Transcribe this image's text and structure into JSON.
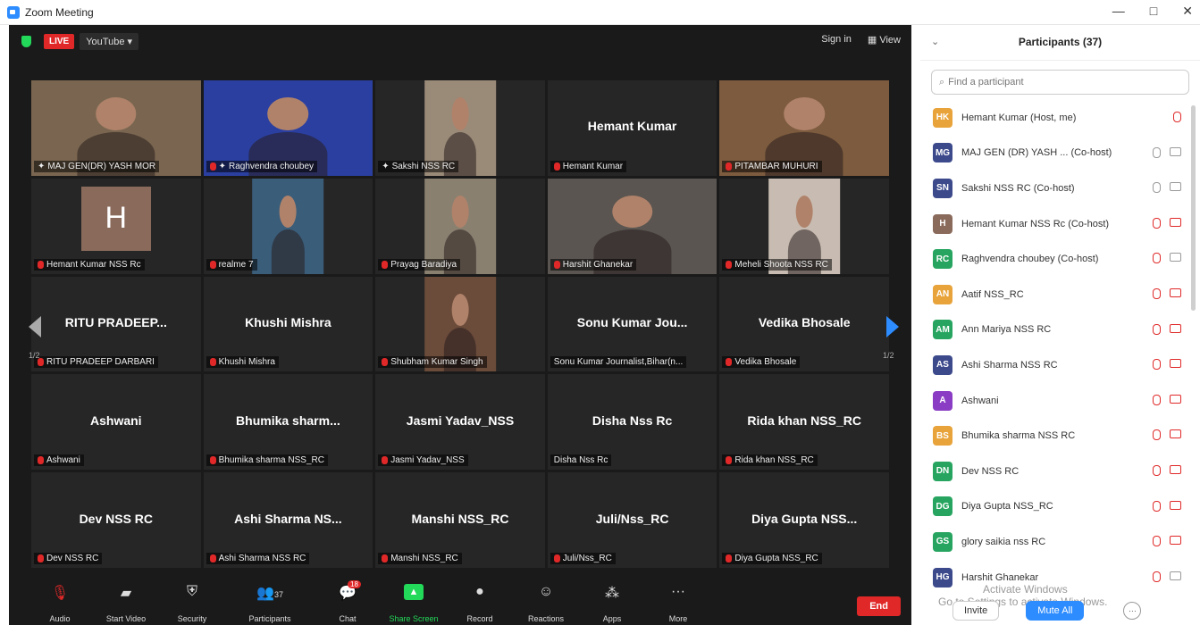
{
  "window": {
    "title": "Zoom Meeting",
    "minimize": "—",
    "restore": "□",
    "close": "✕"
  },
  "topbar": {
    "live": "LIVE",
    "stream": "YouTube ▾",
    "sign_in": "Sign in",
    "view": "View"
  },
  "tiles": [
    {
      "name": "",
      "label": "MAJ GEN(DR) YASH MOR",
      "muted": false,
      "video": true,
      "pinned": true,
      "active": true,
      "bg": "#7a6650"
    },
    {
      "name": "",
      "label": "Raghvendra choubey",
      "muted": true,
      "video": true,
      "pinned": true,
      "bg": "#2a3fa0"
    },
    {
      "name": "",
      "label": "Sakshi NSS RC",
      "muted": false,
      "video": true,
      "pinned": true,
      "bg": "#9a8a78"
    },
    {
      "name": "Hemant Kumar",
      "label": "Hemant Kumar",
      "muted": true,
      "video": false
    },
    {
      "name": "",
      "label": "PITAMBAR MUHURI",
      "muted": true,
      "video": true,
      "bg": "#7d5b3e"
    },
    {
      "name": "",
      "label": "Hemant Kumar NSS Rc",
      "muted": true,
      "video": false,
      "initial": "H"
    },
    {
      "name": "",
      "label": "realme 7",
      "muted": true,
      "video": true,
      "bg": "#3a5d7a"
    },
    {
      "name": "",
      "label": "Prayag Baradiya",
      "muted": true,
      "video": true,
      "bg": "#8a8070"
    },
    {
      "name": "",
      "label": "Harshit Ghanekar",
      "muted": true,
      "video": true,
      "bg": "#5a5550"
    },
    {
      "name": "",
      "label": "Meheli Shoota NSS RC",
      "muted": true,
      "video": true,
      "bg": "#c8bcb2"
    },
    {
      "name": "RITU PRADEEP...",
      "label": "RITU PRADEEP DARBARI",
      "muted": true,
      "video": false
    },
    {
      "name": "Khushi Mishra",
      "label": "Khushi Mishra",
      "muted": true,
      "video": false
    },
    {
      "name": "",
      "label": "Shubham Kumar Singh",
      "muted": true,
      "video": true,
      "bg": "#6b4b3a"
    },
    {
      "name": "Sonu Kumar Jou...",
      "label": "Sonu Kumar Journalist,Bihar(n...",
      "muted": false,
      "video": false
    },
    {
      "name": "Vedika Bhosale",
      "label": "Vedika Bhosale",
      "muted": true,
      "video": false
    },
    {
      "name": "Ashwani",
      "label": "Ashwani",
      "muted": true,
      "video": false
    },
    {
      "name": "Bhumika sharm...",
      "label": "Bhumika sharma NSS_RC",
      "muted": true,
      "video": false
    },
    {
      "name": "Jasmi Yadav_NSS",
      "label": "Jasmi Yadav_NSS",
      "muted": true,
      "video": false
    },
    {
      "name": "Disha Nss Rc",
      "label": "Disha Nss Rc",
      "muted": false,
      "video": false
    },
    {
      "name": "Rida khan NSS_RC",
      "label": "Rida khan NSS_RC",
      "muted": true,
      "video": false
    },
    {
      "name": "Dev NSS RC",
      "label": "Dev NSS RC",
      "muted": true,
      "video": false
    },
    {
      "name": "Ashi Sharma NS...",
      "label": "Ashi Sharma NSS RC",
      "muted": true,
      "video": false
    },
    {
      "name": "Manshi NSS_RC",
      "label": "Manshi NSS_RC",
      "muted": true,
      "video": false
    },
    {
      "name": "Juli/Nss_RC",
      "label": "Juli/Nss_RC",
      "muted": true,
      "video": false
    },
    {
      "name": "Diya Gupta NSS...",
      "label": "Diya Gupta NSS_RC",
      "muted": true,
      "video": false
    }
  ],
  "paging": {
    "left": "1/2",
    "right": "1/2"
  },
  "toolbar": {
    "audio": "Audio",
    "start_video": "Start Video",
    "security": "Security",
    "participants": "Participants",
    "participants_count": "37",
    "chat": "Chat",
    "chat_badge": "18",
    "share_screen": "Share Screen",
    "record": "Record",
    "reactions": "Reactions",
    "apps": "Apps",
    "more": "More",
    "end": "End"
  },
  "panel": {
    "title": "Participants (37)",
    "search_placeholder": "Find a participant",
    "participants": [
      {
        "initials": "HK",
        "color": "#e8a33a",
        "name": "Hemant Kumar (Host, me)",
        "mic": false,
        "cam": null
      },
      {
        "initials": "MG",
        "color": "#3c4a8c",
        "name": "MAJ GEN (DR) YASH ... (Co-host)",
        "mic": true,
        "cam": true
      },
      {
        "initials": "SN",
        "color": "#3c4a8c",
        "name": "Sakshi NSS RC (Co-host)",
        "mic": true,
        "cam": true
      },
      {
        "initials": "H",
        "color": "#8a6a5b",
        "name": "Hemant Kumar NSS Rc (Co-host)",
        "mic": false,
        "cam": false
      },
      {
        "initials": "RC",
        "color": "#27a560",
        "name": "Raghvendra choubey (Co-host)",
        "mic": false,
        "cam": true
      },
      {
        "initials": "AN",
        "color": "#e8a33a",
        "name": "Aatif NSS_RC",
        "mic": false,
        "cam": false
      },
      {
        "initials": "AM",
        "color": "#27a560",
        "name": "Ann Mariya NSS RC",
        "mic": false,
        "cam": false
      },
      {
        "initials": "AS",
        "color": "#3c4a8c",
        "name": "Ashi Sharma NSS RC",
        "mic": false,
        "cam": false
      },
      {
        "initials": "A",
        "color": "#8a3cc4",
        "name": "Ashwani",
        "mic": false,
        "cam": false
      },
      {
        "initials": "BS",
        "color": "#e8a33a",
        "name": "Bhumika sharma NSS RC",
        "mic": false,
        "cam": false
      },
      {
        "initials": "DN",
        "color": "#27a560",
        "name": "Dev NSS RC",
        "mic": false,
        "cam": false
      },
      {
        "initials": "DG",
        "color": "#27a560",
        "name": "Diya Gupta NSS_RC",
        "mic": false,
        "cam": false
      },
      {
        "initials": "GS",
        "color": "#27a560",
        "name": "glory saikia nss RC",
        "mic": false,
        "cam": false
      },
      {
        "initials": "HG",
        "color": "#3c4a8c",
        "name": "Harshit Ghanekar",
        "mic": false,
        "cam": true
      }
    ],
    "watermark_1": "Activate Windows",
    "watermark_2": "Go to Settings to activate Windows.",
    "invite": "Invite",
    "mute_all": "Mute All",
    "more": "···"
  }
}
